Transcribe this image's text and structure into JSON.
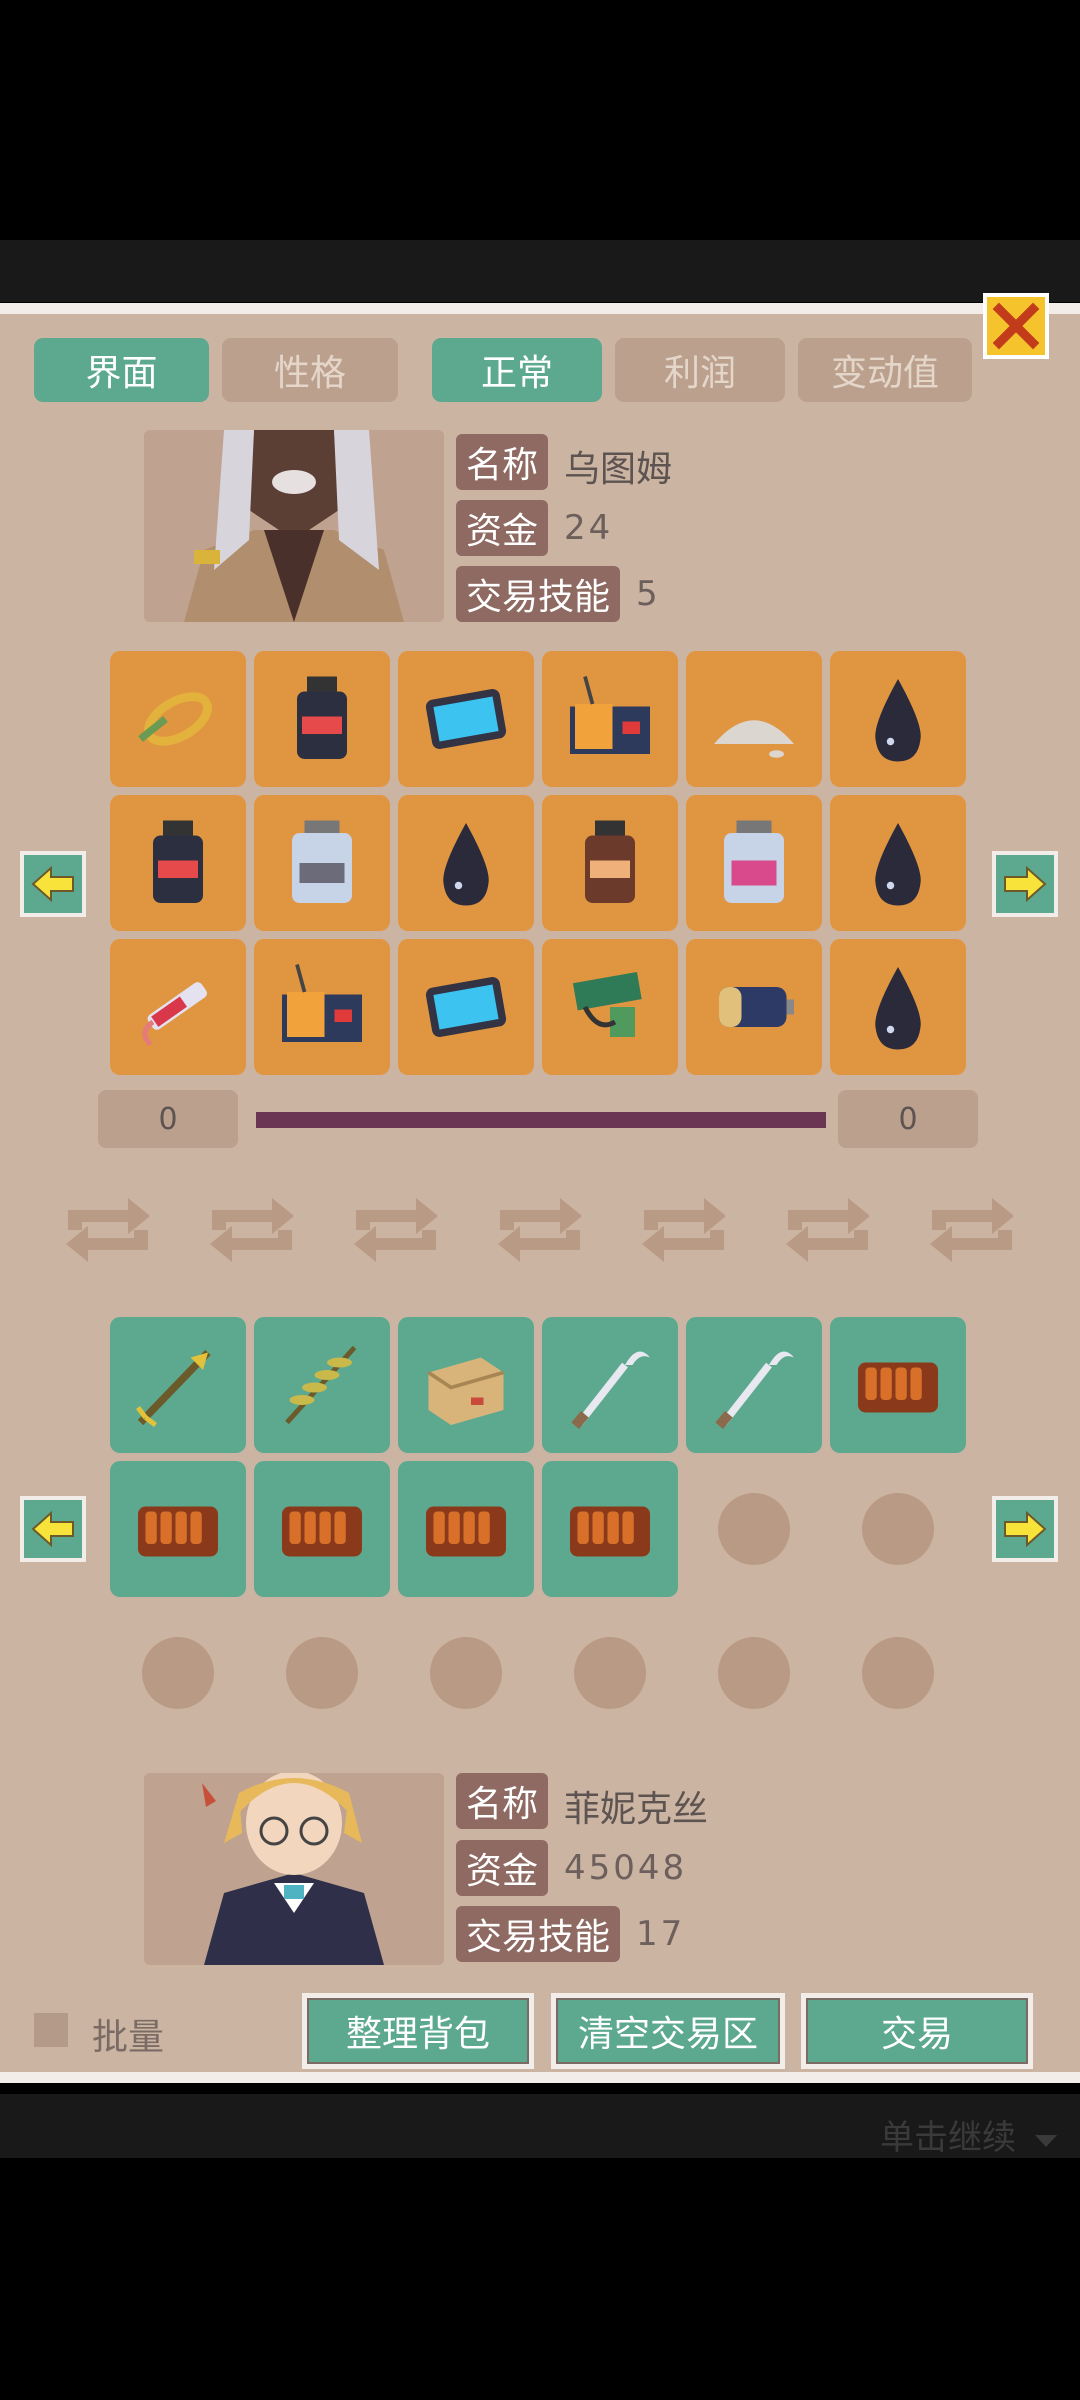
{
  "tabs": {
    "view": "界面",
    "personality": "性格",
    "normal": "正常",
    "profit": "利润",
    "change_value": "变动值"
  },
  "merchant": {
    "name_label": "名称",
    "name": "乌图姆",
    "funds_label": "资金",
    "funds": "24",
    "skill_label": "交易技能",
    "skill": "5"
  },
  "player": {
    "name_label": "名称",
    "name": "菲妮克丝",
    "funds_label": "资金",
    "funds": "45048",
    "skill_label": "交易技能",
    "skill": "17"
  },
  "trade": {
    "left_count": "0",
    "right_count": "0"
  },
  "buttons": {
    "batch": "批量",
    "sort": "整理背包",
    "clear": "清空交易区",
    "trade": "交易"
  },
  "hint": "单击继续",
  "merchant_items": [
    "rope",
    "dark-bottle",
    "tablet",
    "radio",
    "powder-pile",
    "oil-drop",
    "dark-bottle",
    "glass-jar",
    "oil-drop",
    "brown-bottle",
    "pink-jar",
    "oil-drop",
    "syringe",
    "radio",
    "tablet",
    "circuit-board",
    "battery",
    "oil-drop"
  ],
  "player_items": [
    "arrow",
    "herb-branch",
    "cardboard-box",
    "hook-blade",
    "hook-blade",
    "ammo-belt",
    "ammo-belt",
    "ammo-belt",
    "ammo-belt",
    "ammo-belt"
  ],
  "colors": {
    "accent_green": "#5da98f",
    "slot_orange": "#e09641",
    "close_yellow": "#f5c42c",
    "label_brown": "#8e6a62"
  }
}
